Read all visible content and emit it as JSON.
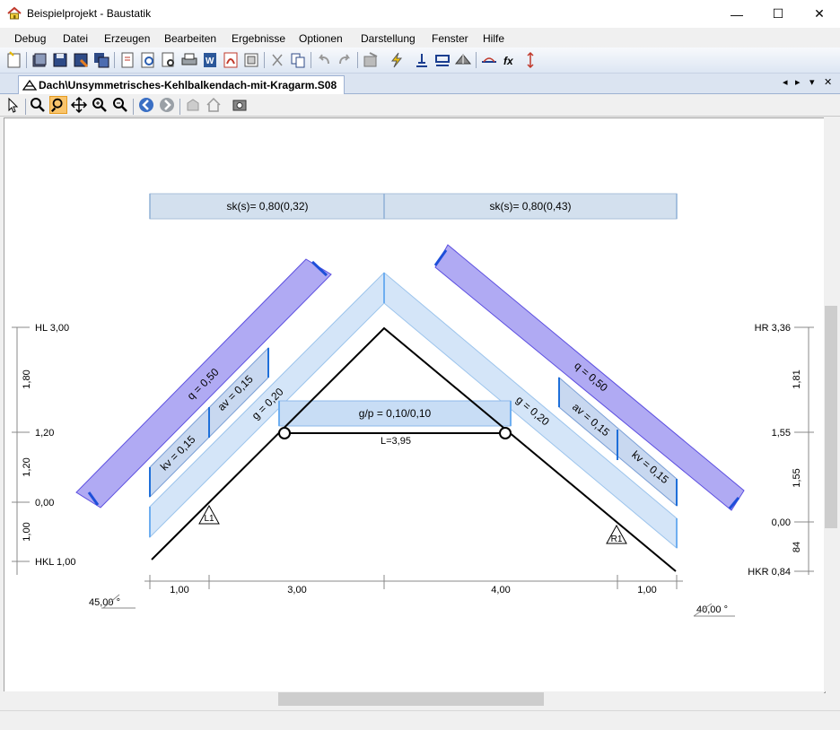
{
  "window": {
    "title": "Beispielprojekt - Baustatik",
    "minimize": "—",
    "maximize": "☐",
    "close": "✕"
  },
  "menu": [
    "Debug",
    "Datei",
    "Erzeugen",
    "Bearbeiten",
    "Ergebnisse",
    "Optionen",
    "Darstellung",
    "Fenster",
    "Hilfe"
  ],
  "tab": {
    "label": "Dach\\Unsymmetrisches-Kehlbalkendach-mit-Kragarm.S08"
  },
  "drawing": {
    "snow_left": "sk(s)= 0,80(0,32)",
    "snow_right": "sk(s)= 0,80(0,43)",
    "q_left": "q = 0,50",
    "q_right": "q = 0,50",
    "av_left": "av = 0,15",
    "av_right": "av = 0,15",
    "kv_left": "kv = 0,15",
    "kv_right": "kv = 0,15",
    "g_left": "g = 0,20",
    "g_right": "g = 0,20",
    "gp_collar": "g/p = 0,10/0,10",
    "collar_length": "L=3,95",
    "support_left": "L1",
    "support_right": "R1",
    "level_hl": "HL 3,00",
    "level_hr": "HR 3,36",
    "level_hkl": "HKL 1,00",
    "level_hkr": "HKR 0,84",
    "left_levels": [
      "1,20",
      "0,00"
    ],
    "right_levels": [
      "1,55",
      "0,00"
    ],
    "left_dims": [
      "1,80",
      "1,20",
      "1,00"
    ],
    "right_dims": [
      "1,81",
      "1,55",
      "84"
    ],
    "bottom_dims": [
      "1,00",
      "3,00",
      "4,00",
      "1,00"
    ],
    "angle_left": "45,00 °",
    "angle_right": "40,00 °"
  }
}
